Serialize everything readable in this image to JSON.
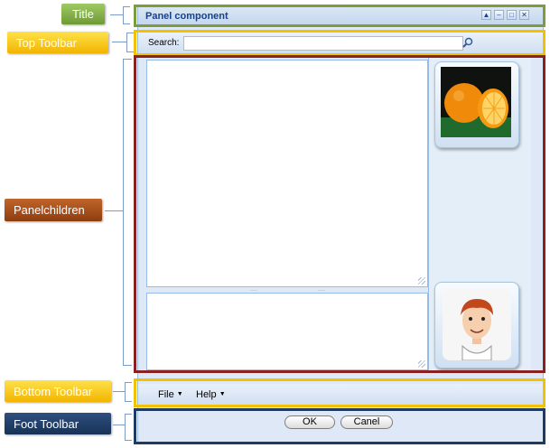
{
  "callouts": {
    "title": "Title",
    "top_toolbar": "Top Toolbar",
    "panel_children": "Panelchildren",
    "bottom_toolbar": "Bottom Toolbar",
    "foot_toolbar": "Foot Toolbar"
  },
  "panel": {
    "title": "Panel component",
    "tools": [
      "up-icon",
      "minimize-icon",
      "maximize-icon",
      "close-icon"
    ]
  },
  "top_toolbar": {
    "search_label": "Search:",
    "search_value": "",
    "search_icon": "magnifier-icon"
  },
  "images": [
    "oranges-photo",
    "cartoon-avatar"
  ],
  "bottom_toolbar": {
    "menus": [
      {
        "label": "File",
        "icon": "dropdown-arrow-icon"
      },
      {
        "label": "Help",
        "icon": "dropdown-arrow-icon"
      }
    ]
  },
  "foot_toolbar": {
    "ok_label": "OK",
    "cancel_label": "Canel"
  },
  "colors": {
    "title_frame": "#7f9c3c",
    "toolbar_frame": "#f2c200",
    "children_frame": "#8b2020",
    "foot_frame": "#1f3b64"
  }
}
